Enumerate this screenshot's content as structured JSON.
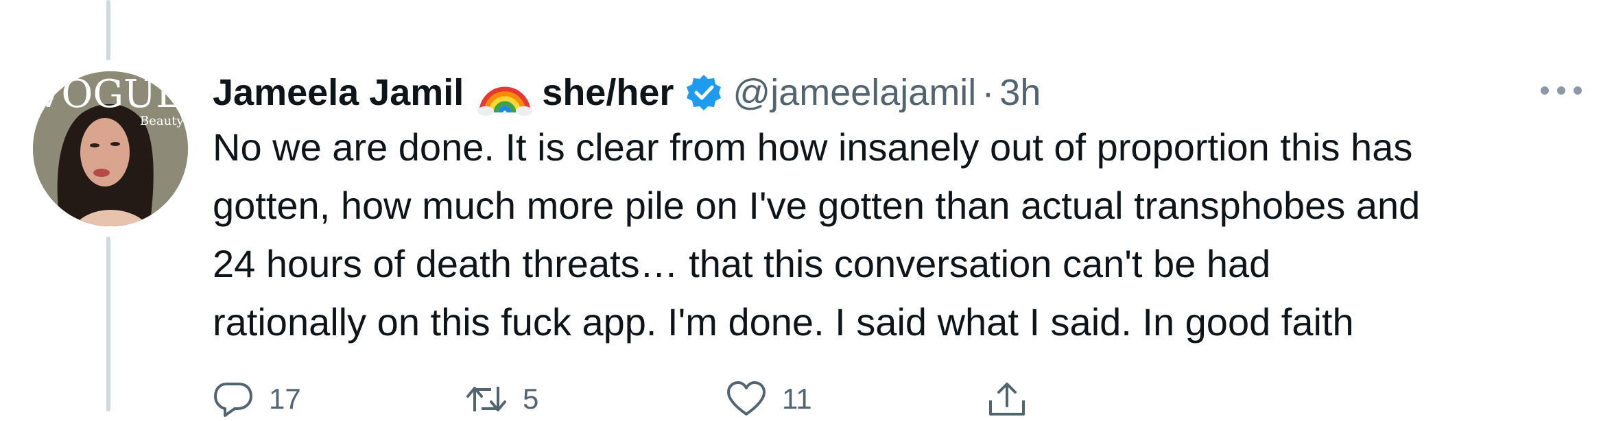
{
  "tweet": {
    "author": {
      "display_name": "Jameela Jamil",
      "pronouns": "she/her",
      "handle": "@jameelajamil",
      "separator": "·",
      "time": "3h",
      "avatar_caption_main": "VOGUE",
      "avatar_caption_sub": "Beauty"
    },
    "text_lines": [
      "No we are done. It is clear from how insanely out of proportion this has",
      "gotten, how much more pile on I've gotten than actual transphobes and",
      "24 hours of death threats… that this conversation can't be had",
      "rationally on this fuck app. I'm done. I said what I said. In good faith"
    ],
    "actions": {
      "reply_count": "17",
      "retweet_count": "5",
      "like_count": "11"
    },
    "icons": {
      "rainbow": "rainbow-icon",
      "verified": "verified-badge-icon",
      "more": "more-options-icon",
      "reply": "reply-icon",
      "retweet": "retweet-icon",
      "like": "heart-icon",
      "share": "share-icon"
    },
    "colors": {
      "verified_blue": "#1d9bf0",
      "text_primary": "#0f1419",
      "text_secondary": "#536471",
      "thread_line": "#cfd9de"
    }
  }
}
